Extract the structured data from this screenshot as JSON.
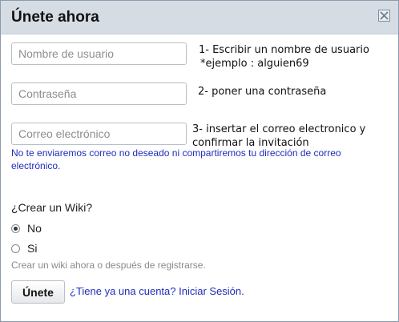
{
  "dialog": {
    "title": "Únete ahora",
    "close_icon": "close-icon"
  },
  "fields": {
    "username_placeholder": "Nombre de usuario",
    "password_placeholder": "Contraseña",
    "email_placeholder": "Correo electrónico"
  },
  "notes": {
    "step1_line1": "1- Escribir  un nombre de usuario",
    "step1_line2": "*ejemplo : alguien69",
    "step2": "2- poner una contraseña",
    "step3_line1": "3- insertar el correo electronico y",
    "step3_line2": "confirmar la invitación"
  },
  "privacy_note": "No te enviaremos correo no deseado ni compartiremos tu dirección de correo electrónico.",
  "wiki": {
    "question": "¿Crear un Wiki?",
    "options": [
      {
        "label": "No",
        "selected": true
      },
      {
        "label": "Si",
        "selected": false
      }
    ],
    "hint": "Crear un wiki ahora o después de registrarse."
  },
  "actions": {
    "join_label": "Únete",
    "login_link": "¿Tiene ya una cuenta? Iniciar Sesión."
  },
  "colors": {
    "titlebar": "#d6dce4",
    "link": "#1f2dbb",
    "hint": "#8a8a8a"
  }
}
